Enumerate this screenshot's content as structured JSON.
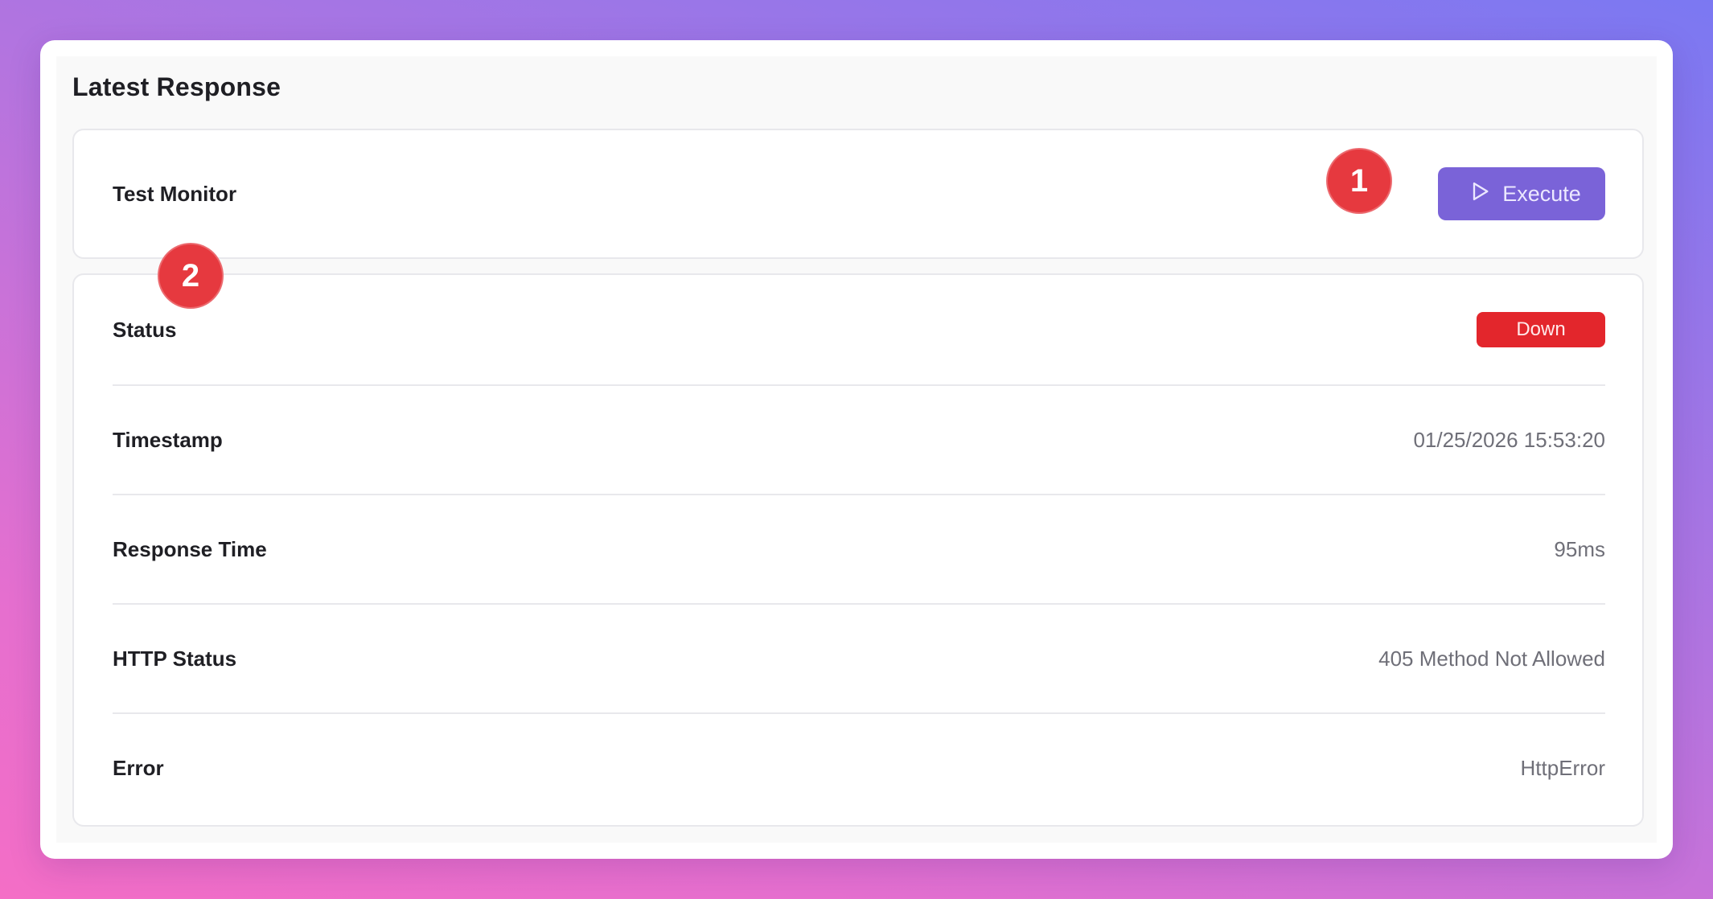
{
  "panel": {
    "title": "Latest Response"
  },
  "monitor": {
    "name": "Test Monitor",
    "execute_label": "Execute",
    "execute_icon": "play-icon"
  },
  "callouts": [
    "1",
    "2"
  ],
  "details": {
    "status": {
      "label": "Status",
      "value": "Down",
      "color": "#e3262c"
    },
    "timestamp": {
      "label": "Timestamp",
      "value": "01/25/2026 15:53:20"
    },
    "response_time": {
      "label": "Response Time",
      "value": "95ms"
    },
    "http_status": {
      "label": "HTTP Status",
      "value": "405 Method Not Allowed"
    },
    "error": {
      "label": "Error",
      "value": "HttpError"
    }
  },
  "colors": {
    "accent": "#7a63d8",
    "danger": "#e3262c",
    "callout": "#e6393f"
  }
}
